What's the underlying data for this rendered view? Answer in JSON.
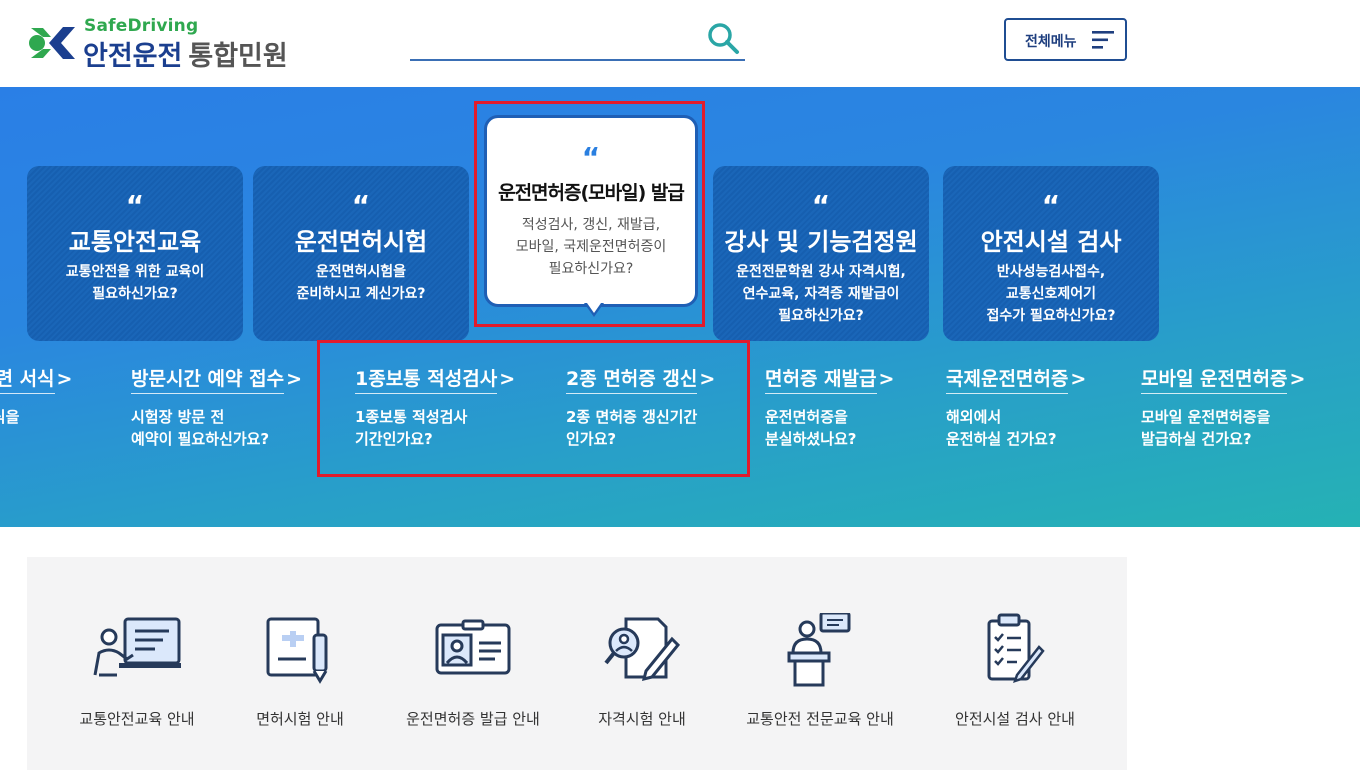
{
  "header": {
    "logo_sub": "SafeDriving",
    "logo_main": "안전운전",
    "logo_main_gray": "통합민원",
    "search_placeholder": "",
    "all_menu_label": "전체메뉴"
  },
  "cards": [
    {
      "title": "교통안전교육",
      "desc": "교통안전을 위한 교육이\n필요하신가요?"
    },
    {
      "title": "운전면허시험",
      "desc": "운전면허시험을\n준비하시고 계신가요?"
    },
    {
      "title": "운전면허증(모바일) 발급",
      "desc": "적성검사, 갱신, 재발급,\n모바일, 국제운전면허증이\n필요하신가요?"
    },
    {
      "title": "강사 및 기능검정원",
      "desc": "운전전문학원 강사 자격시험,\n연수교육, 자격증 재발급이\n필요하신가요?"
    },
    {
      "title": "안전시설 검사",
      "desc": "반사성능검사접수,\n교통신호제어기\n접수가 필요하신가요?"
    }
  ],
  "quote_mark": "“",
  "sublinks": [
    {
      "title": "관련 서식",
      "desc": "서식을"
    },
    {
      "title": "방문시간 예약 접수",
      "desc": "시험장 방문 전\n예약이 필요하신가요?"
    },
    {
      "title": "1종보통 적성검사",
      "desc": "1종보통 적성검사\n기간인가요?"
    },
    {
      "title": "2종 면허증 갱신",
      "desc": "2종 면허증 갱신기간\n인가요?"
    },
    {
      "title": "면허증 재발급",
      "desc": "운전면허증을\n분실하셨나요?"
    },
    {
      "title": "국제운전면허증",
      "desc": "해외에서\n운전하실 건가요?"
    },
    {
      "title": "모바일 운전면허증",
      "desc": "모바일 운전면허증을\n발급하실 건가요?"
    }
  ],
  "arrow": ">",
  "services": [
    {
      "label": "교통안전교육 안내",
      "icon": "lecture-icon"
    },
    {
      "label": "면허시험 안내",
      "icon": "exam-document-icon"
    },
    {
      "label": "운전면허증 발급 안내",
      "icon": "license-card-icon"
    },
    {
      "label": "자격시험 안내",
      "icon": "qualification-search-icon"
    },
    {
      "label": "교통안전 전문교육 안내",
      "icon": "podium-speaker-icon"
    },
    {
      "label": "안전시설 검사 안내",
      "icon": "checklist-clipboard-icon"
    }
  ],
  "colors": {
    "brand_blue": "#1b3f8f",
    "brand_green": "#2fa84f",
    "highlight_red": "#e21b2c",
    "hero_start": "#2a7fe6",
    "hero_end": "#25b2b4"
  }
}
